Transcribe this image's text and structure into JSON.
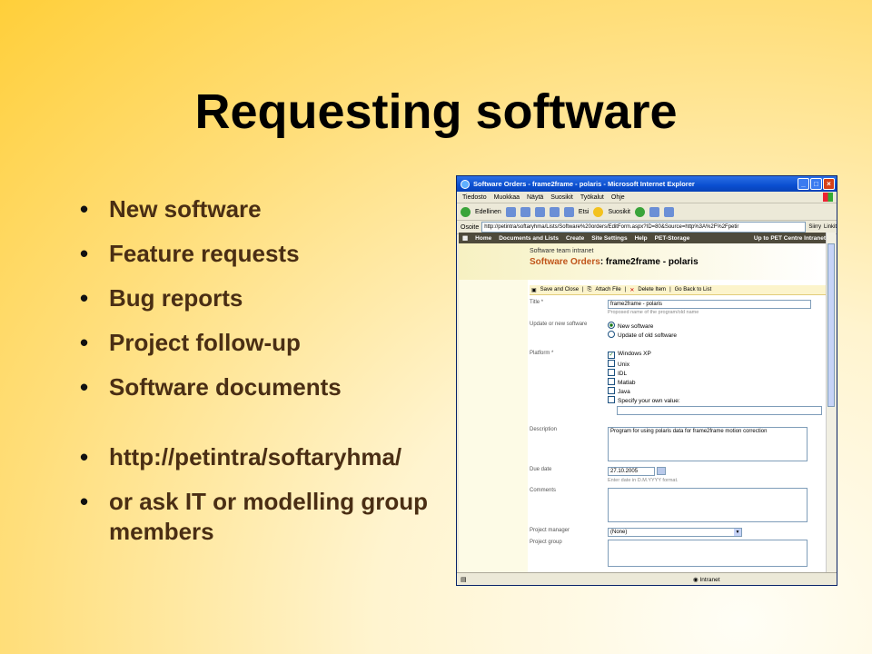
{
  "slide": {
    "title": "Requesting software",
    "bullets": [
      "New software",
      "Feature requests",
      "Bug reports",
      "Project follow-up",
      "Software documents"
    ],
    "extra_bullets": [
      "http://petintra/softaryhma/",
      "or ask IT or modelling group members"
    ]
  },
  "browser": {
    "window_title": "Software Orders - frame2frame - polaris - Microsoft Internet Explorer",
    "menu": [
      "Tiedosto",
      "Muokkaa",
      "Näytä",
      "Suosikit",
      "Työkalut",
      "Ohje"
    ],
    "toolbar": {
      "back": "Edellinen",
      "search": "Etsi",
      "favorites": "Suosikit"
    },
    "address_label": "Osoite",
    "address_value": "http://petintra/softaryhma/Lists/Software%20orders/EditForm.aspx?ID=80&Source=http%3A%2F%2Fpetir",
    "go_label": "Siirry",
    "links_label": "Linkit",
    "status_zone": "Intranet"
  },
  "site": {
    "topnav": [
      "Home",
      "Documents and Lists",
      "Create",
      "Site Settings",
      "Help",
      "PET-Storage"
    ],
    "topnav_right": "Up to PET Centre Intranet",
    "site_name": "Software team intranet",
    "list_name": "Software Orders",
    "item_name": ": frame2frame - polaris",
    "actions": [
      "Save and Close",
      "Attach File",
      "Delete Item",
      "Go Back to List"
    ]
  },
  "form": {
    "title_label": "Title *",
    "title_value": "frame2frame - polaris",
    "title_hint": "Proposed name of the program/old name",
    "type_label": "Update or new software",
    "type_options": [
      "New software",
      "Update of old software"
    ],
    "platform_label": "Platform *",
    "platform_options": [
      "Windows XP",
      "Unix",
      "IDL",
      "Matlab",
      "Java",
      "Specify your own value:"
    ],
    "platform_checked": "Windows XP",
    "description_label": "Description",
    "description_value": "Program for using polaris data for frame2frame motion correction",
    "due_label": "Due date",
    "due_value": "27.10.2005",
    "due_hint": "Enter date in D.M.YYYY format.",
    "comments_label": "Comments",
    "pm_label": "Project manager",
    "pm_value": "(None)",
    "group_label": "Project group"
  }
}
